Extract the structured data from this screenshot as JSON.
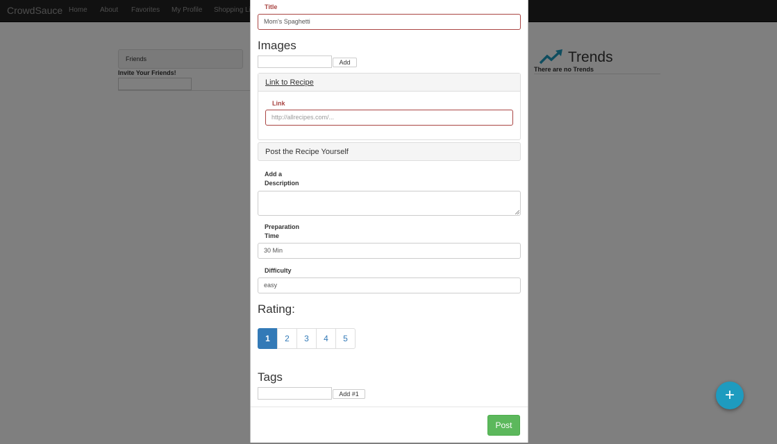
{
  "navbar": {
    "brand": "CrowdSauce",
    "items": [
      "Home",
      "About",
      "Favorites",
      "My Profile",
      "Shopping Li"
    ]
  },
  "sidebar": {
    "friends_title": "Friends",
    "invite_label": "Invite Your Friends!"
  },
  "trends": {
    "title": "Trends",
    "empty_text": "There are no Trends",
    "icon": "trending-up-icon"
  },
  "fab": {
    "label": "+",
    "icon": "plus-icon"
  },
  "modal": {
    "title_label": "Title",
    "title_value": "Mom's Spaghetti",
    "images_heading": "Images",
    "images_add_label": "Add",
    "link_panel_title": "Link to Recipe",
    "link_label": "Link",
    "link_placeholder": "http://allrecipes.com/...",
    "post_panel_title": "Post the Recipe Yourself",
    "description_label_line1": "Add a",
    "description_label_line2": "Description",
    "prep_label_line1": "Preparation",
    "prep_label_line2": "Time",
    "prep_value": "30 Min",
    "difficulty_label": "Difficulty",
    "difficulty_value": "easy",
    "rating_heading": "Rating:",
    "rating_pages": [
      "1",
      "2",
      "3",
      "4",
      "5"
    ],
    "rating_selected": "1",
    "tags_heading": "Tags",
    "tags_add_label": "Add #1",
    "post_label": "Post"
  },
  "colors": {
    "accent": "#337ab7",
    "error": "#a94442",
    "success": "#5cb85c",
    "fab": "#1e9bbf",
    "navbar": "#222222"
  }
}
